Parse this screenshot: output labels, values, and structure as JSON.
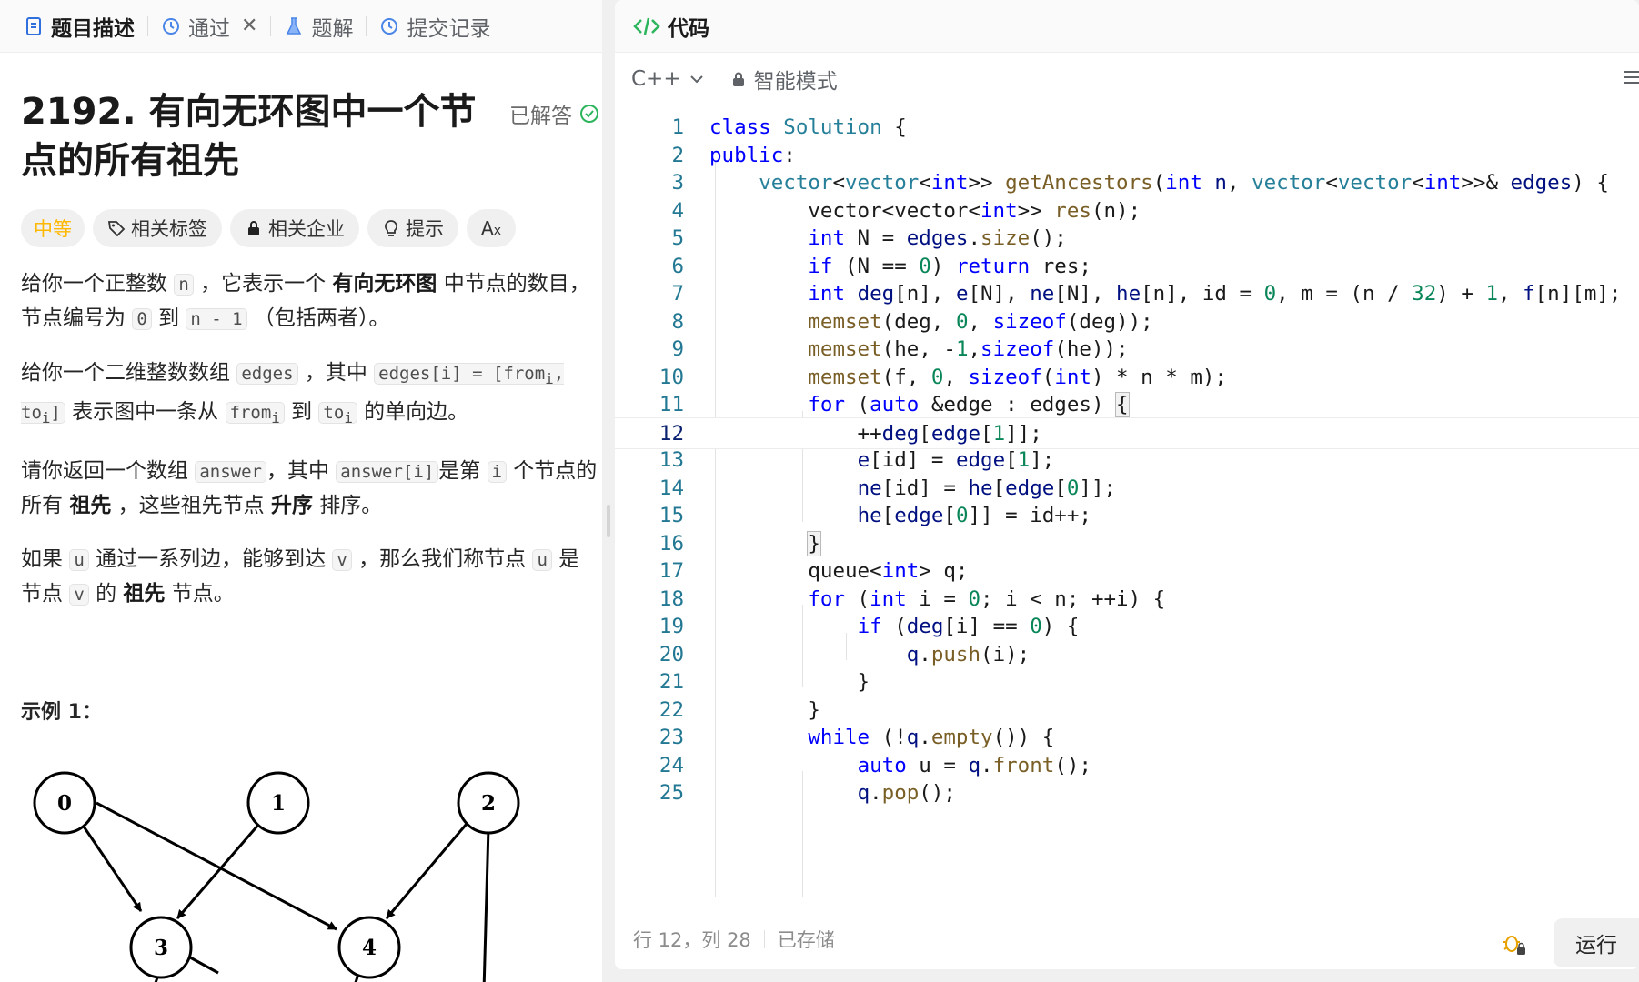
{
  "tabs": {
    "description": "题目描述",
    "passed": "通过",
    "solutions": "题解",
    "submissions": "提交记录"
  },
  "problem": {
    "title": "2192. 有向无环图中一个节点的所有祖先",
    "status": "已解答",
    "difficulty": "中等",
    "pills": [
      "相关标签",
      "相关企业",
      "提示"
    ],
    "example_label": "示例 1："
  },
  "graph": {
    "nodes": [
      "0",
      "1",
      "2",
      "3",
      "4"
    ]
  },
  "editor": {
    "header": "代码",
    "language": "C++",
    "mode": "智能模式",
    "current_line": 12,
    "line_numbers": [
      "1",
      "2",
      "3",
      "4",
      "5",
      "6",
      "7",
      "8",
      "9",
      "10",
      "11",
      "12",
      "13",
      "14",
      "15",
      "16",
      "17",
      "18",
      "19",
      "20",
      "21",
      "22",
      "23",
      "24",
      "25"
    ]
  },
  "status": {
    "position": "行 12，列 28",
    "saved": "已存储",
    "run_label": "运行"
  },
  "colors": {
    "keyword": "#0000ff",
    "type": "#267f99",
    "function": "#795e26",
    "number": "#098658",
    "difficulty": "#ffb800",
    "solved_check": "#2db55d"
  }
}
